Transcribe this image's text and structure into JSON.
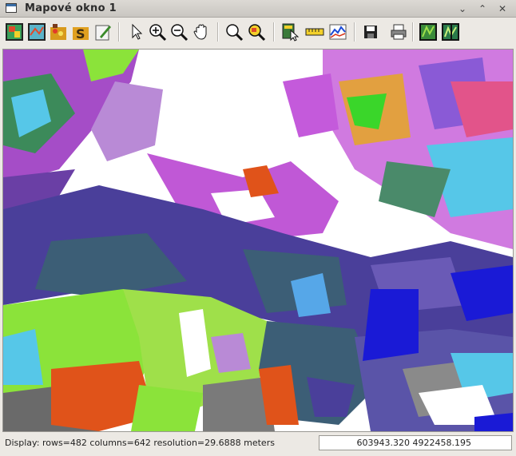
{
  "window": {
    "title": "Mapové okno 1"
  },
  "toolbar": {
    "tools": [
      "add-raster-icon",
      "add-vector-icon",
      "add-other-icon",
      "add-overlay-icon",
      "edit-icon",
      "pointer-icon",
      "zoom-in-icon",
      "zoom-out-icon",
      "pan-icon",
      "zoom-back-icon",
      "zoom-region-icon",
      "query-icon",
      "measure-icon",
      "profile-icon",
      "save-icon",
      "print-icon",
      "map-display-icon",
      "map-display-compare-icon"
    ]
  },
  "map": {
    "description_color_palette": [
      "#ffffff",
      "#4a3f9a",
      "#3c5e76",
      "#8be33a",
      "#a54dc7",
      "#e0531a",
      "#56c7e8",
      "#7f7f7f",
      "#1a1ad6",
      "#9fc95a"
    ]
  },
  "status": {
    "display_text": "Display: rows=482 columns=642  resolution=29.6888 meters",
    "coordinates": "603943.320 4922458.195"
  }
}
